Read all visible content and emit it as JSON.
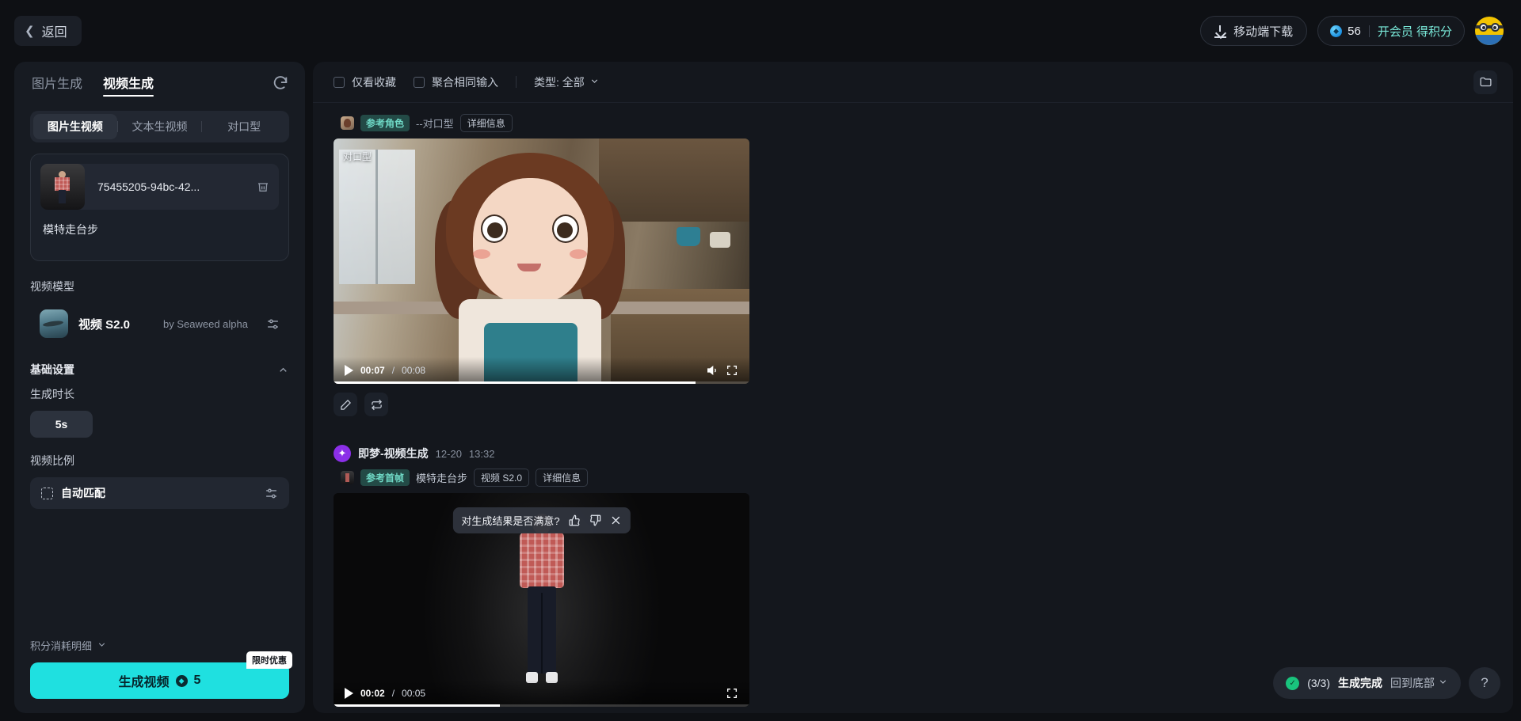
{
  "header": {
    "back_label": "返回",
    "download_label": "移动端下载",
    "credits": "56",
    "vip_label": "开会员 得积分",
    "coin_glyph": "◆"
  },
  "sidebar": {
    "tabs": [
      {
        "label": "图片生成",
        "active": false
      },
      {
        "label": "视频生成",
        "active": true
      }
    ],
    "sub_tabs": [
      {
        "label": "图片生视频",
        "active": true
      },
      {
        "label": "文本生视频",
        "active": false
      },
      {
        "label": "对口型",
        "active": false
      }
    ],
    "upload": {
      "file_name": "75455205-94bc-42...",
      "prompt": "模特走台步"
    },
    "model_section": {
      "label": "视频模型",
      "name": "视频 S2.0",
      "by": "by Seaweed alpha"
    },
    "basic_settings": {
      "label": "基础设置",
      "duration_label": "生成时长",
      "duration_value": "5s",
      "ratio_label": "视频比例",
      "ratio_value": "自动匹配"
    },
    "footer": {
      "detail_label": "积分消耗明细",
      "generate_label": "生成视频",
      "generate_cost": "5",
      "promo_label": "限时优惠"
    }
  },
  "main": {
    "toolbar": {
      "favorites_only": "仅看收藏",
      "aggregate_same": "聚合相同输入",
      "type_filter": "类型: 全部"
    },
    "items": [
      {
        "ref_badge": "参考角色",
        "meta_text": "--对口型",
        "detail_label": "详细信息",
        "overlay_tag": "对口型",
        "time_current": "00:07",
        "time_sep": "/",
        "time_duration": "00:08",
        "progress_percent": 87
      },
      {
        "title": "即梦-视频生成",
        "date": "12-20",
        "time": "13:32",
        "ref_badge": "参考首帧",
        "meta_text": "模特走台步",
        "model_tag": "视频 S2.0",
        "detail_label": "详细信息",
        "time_current": "00:02",
        "time_sep": "/",
        "time_duration": "00:05",
        "progress_percent": 40,
        "feedback_question": "对生成结果是否满意?"
      }
    ],
    "status": {
      "count": "(3/3)",
      "text": "生成完成",
      "back_to_bottom": "回到底部",
      "help": "?"
    }
  }
}
